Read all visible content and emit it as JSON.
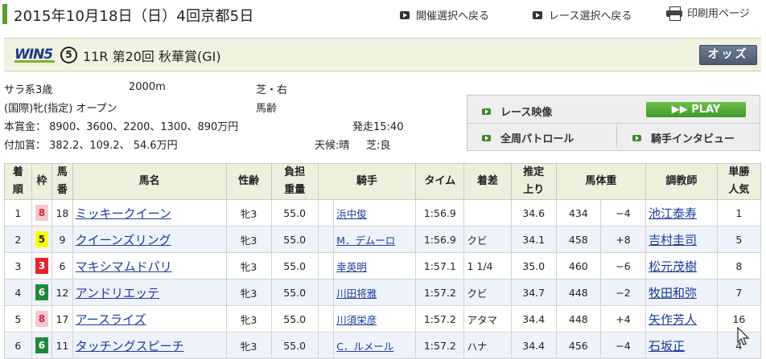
{
  "header": {
    "date": "2015年10月18日（日）4回京都5日",
    "links": [
      {
        "label": "開催選択へ戻る"
      },
      {
        "label": "レース選択へ戻る"
      },
      {
        "label": "印刷用ページ"
      }
    ]
  },
  "race": {
    "win5_logo": "WIN5",
    "win5_leg": "⑤",
    "title": "11R 第20回 秋華賞(GI)",
    "odds_button": "オッズ",
    "conditions": {
      "class": "サラ系3歳",
      "distance": "2000m",
      "surface": "芝・右",
      "type": "(国際)牝(指定) オープン",
      "weight_rule": "馬齢",
      "prize": "本賞金： 8900、3600、2200、1300、890万円",
      "start": "発走15:40",
      "added": "付加賞： 382.2、109.2、 54.6万円",
      "weather": "天候:晴",
      "going": "芝:良"
    }
  },
  "media": {
    "race_video": "レース映像",
    "play": "PLAY",
    "patrol": "全周パトロール",
    "interview": "騎手インタビュー"
  },
  "table": {
    "headers": {
      "chakujun": [
        "着",
        "順"
      ],
      "waku": "枠",
      "umaban": [
        "馬",
        "番"
      ],
      "horse": "馬名",
      "sexage": "性齢",
      "weight": [
        "負担",
        "重量"
      ],
      "jockey": "騎手",
      "time": "タイム",
      "margin": "着差",
      "agari": [
        "推定",
        "上り"
      ],
      "bodyweight": "馬体重",
      "trainer": "調教師",
      "popularity": [
        "単勝",
        "人気"
      ]
    },
    "rows": [
      {
        "rank": "1",
        "waku": "8",
        "waku_bg": "#f7c8d0",
        "waku_fg": "#d0253a",
        "num": "18",
        "horse": "ミッキークイーン",
        "sexage": "牝3",
        "weight": "55.0",
        "jockey": "浜中俊",
        "time": "1:56.9",
        "margin": "",
        "agari": "34.6",
        "bw": "434",
        "bwd": "−4",
        "trainer": "池江泰寿",
        "pop": "1"
      },
      {
        "rank": "2",
        "waku": "5",
        "waku_bg": "#ffff00",
        "waku_fg": "#222222",
        "num": "9",
        "horse": "クイーンズリング",
        "sexage": "牝3",
        "weight": "55.0",
        "jockey": "M．デムーロ",
        "time": "1:56.9",
        "margin": "クビ",
        "agari": "34.1",
        "bw": "458",
        "bwd": "+8",
        "trainer": "吉村圭司",
        "pop": "5"
      },
      {
        "rank": "3",
        "waku": "3",
        "waku_bg": "#e8242a",
        "waku_fg": "#ffffff",
        "num": "6",
        "horse": "マキシマムドパリ",
        "sexage": "牝3",
        "weight": "55.0",
        "jockey": "幸英明",
        "time": "1:57.1",
        "margin": "1 1/4",
        "agari": "35.0",
        "bw": "460",
        "bwd": "−6",
        "trainer": "松元茂樹",
        "pop": "8"
      },
      {
        "rank": "4",
        "waku": "6",
        "waku_bg": "#1f8b3a",
        "waku_fg": "#ffffff",
        "num": "12",
        "horse": "アンドリエッテ",
        "sexage": "牝3",
        "weight": "55.0",
        "jockey": "川田将雅",
        "time": "1:57.2",
        "margin": "クビ",
        "agari": "34.7",
        "bw": "448",
        "bwd": "−2",
        "trainer": "牧田和弥",
        "pop": "7"
      },
      {
        "rank": "5",
        "waku": "8",
        "waku_bg": "#f7c8d0",
        "waku_fg": "#d0253a",
        "num": "17",
        "horse": "アースライズ",
        "sexage": "牝3",
        "weight": "55.0",
        "jockey": "川須栄彦",
        "time": "1:57.2",
        "margin": "アタマ",
        "agari": "34.4",
        "bw": "448",
        "bwd": "+4",
        "trainer": "矢作芳人",
        "pop": "16"
      },
      {
        "rank": "6",
        "waku": "6",
        "waku_bg": "#1f8b3a",
        "waku_fg": "#ffffff",
        "num": "11",
        "horse": "タッチングスピーチ",
        "sexage": "牝3",
        "weight": "55.0",
        "jockey": "C．ルメール",
        "time": "1:57.2",
        "margin": "ハナ",
        "agari": "34.4",
        "bw": "456",
        "bwd": "−4",
        "trainer": "石坂正",
        "pop": "4"
      }
    ]
  }
}
